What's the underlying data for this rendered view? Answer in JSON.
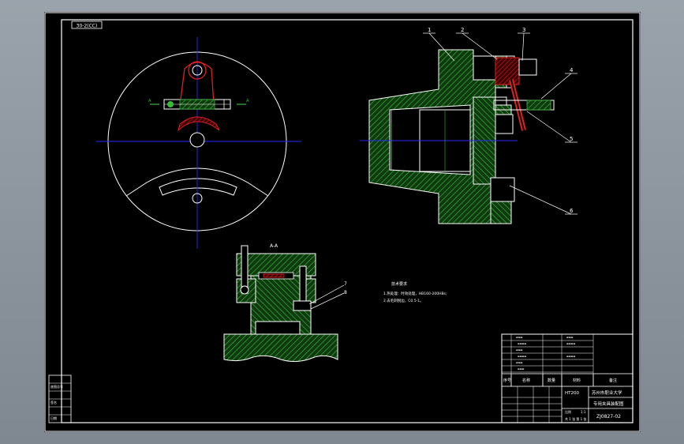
{
  "drawing": {
    "section_label": "A-A",
    "code_box": "30-2(CC)",
    "part_numbers": [
      "1",
      "2",
      "3",
      "4",
      "5",
      "6"
    ],
    "section_part_numbers": [
      "7",
      "8"
    ],
    "tech_notes": {
      "title": "技术要求",
      "line1": "1.热处理：时效处理，HB160-200HBs;",
      "line2": "2.去毛刺锐边，C0.5-1。"
    },
    "left_strip": [
      "底图总号",
      "签名",
      "日期"
    ]
  },
  "title_block": {
    "col_headers": [
      "序号",
      "名称",
      "数量",
      "材料",
      "备注"
    ],
    "material": "HT200",
    "school": "苏州市职业大学",
    "title": "专用夹具装配图",
    "drawing_no": "ZJ0827-02",
    "scale_label": "比例",
    "scale_value": "1:1",
    "sheet_label": "共 1 张 第 1 张"
  },
  "colors": {
    "line": "#ffffff",
    "hatch": "#3cb83c",
    "red": "#e02020",
    "center": "#2a2aff",
    "accent": "#ffff66"
  }
}
